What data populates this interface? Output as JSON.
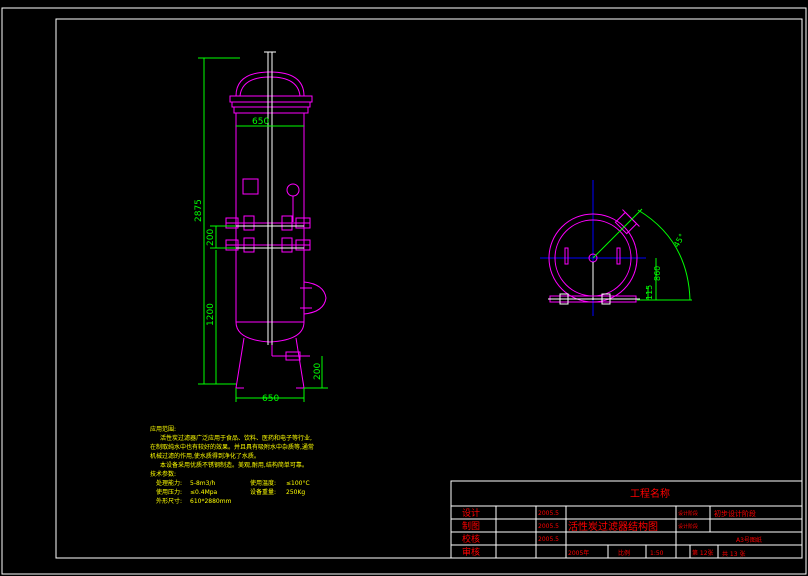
{
  "colors": {
    "background": "#000000",
    "frame": "#ffffff",
    "vessel": "#ff00ff",
    "dimension": "#00ff00",
    "centerline": "#0000ff",
    "pipe_white": "#ffffff",
    "note_text": "#ffff00",
    "title_text": "#ff0000",
    "title_lines": "#ffffff"
  },
  "dimensions": {
    "height_total": "2875",
    "width_top": "650",
    "nozzle_gap": "200",
    "lower_height": "1200",
    "leg_height": "200",
    "width_bottom": "650",
    "plan_860": "860",
    "plan_115": "115",
    "plan_angle": "45°"
  },
  "notes": {
    "heading": "应用范围:",
    "lines": [
      "活性炭过滤器广泛应用于食品、饮料、医药和电子等行业,",
      "在制取纯水中也有较好的效果。并且具有吸附水中杂质等,通常",
      "机械过滤的作用,使水质得到净化了水质。",
      "本设备采用优质不锈钢制造。美观,耐用,结构简单可靠。",
      "技术参数:"
    ],
    "params": [
      [
        "处理能力:",
        "5-8m3/h",
        "使用温度:",
        "≤100°C"
      ],
      [
        "使用压力:",
        "≤0.4Mpa",
        "设备重量:",
        "250Kg"
      ],
      [
        "外形尺寸:",
        "610*2880mm",
        "",
        ""
      ]
    ]
  },
  "title_block": {
    "project_label": "工程名称",
    "design": "设计",
    "draw": "制图",
    "check": "校核",
    "review": "审核",
    "date1": "2005.5",
    "date2": "2005.5",
    "date3": "2005.5",
    "drawing_title": "活性炭过滤器结构图",
    "stage_label_1": "设计阶段",
    "stage_value": "初步设计阶段",
    "stage_label_2": "设计阶段",
    "sheet_size": "A3号图纸",
    "year": "2005年",
    "scale_label": "比例",
    "scale_value": "1:50",
    "sheet_no": "第 12张",
    "sheet_total": "共 13 张"
  }
}
